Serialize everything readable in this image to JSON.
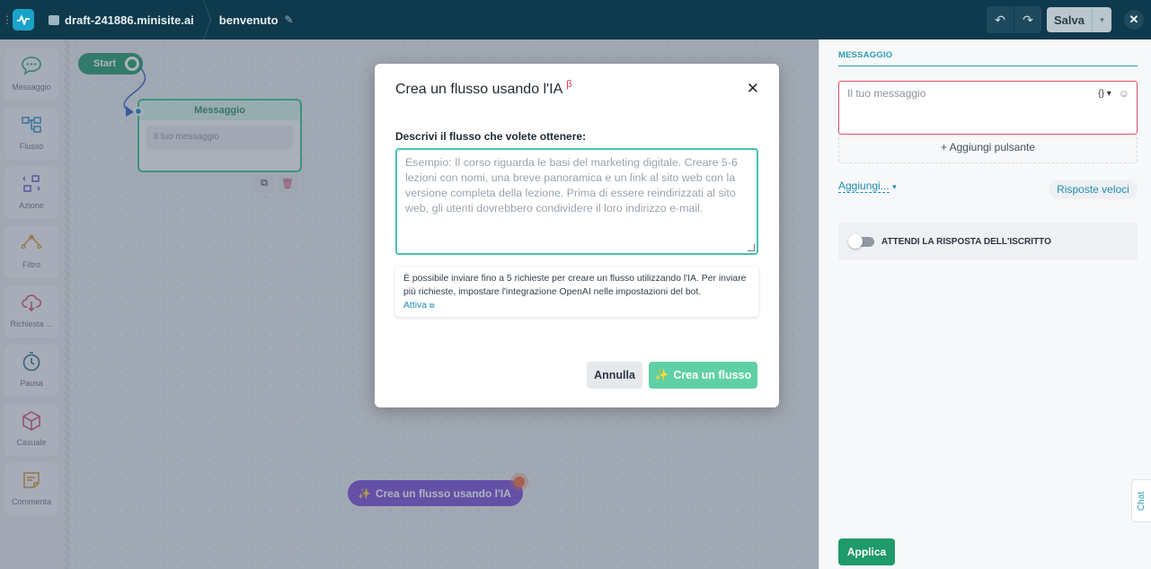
{
  "topbar": {
    "site": "draft-241886.minisite.ai",
    "flow_name": "benvenuto",
    "save_label": "Salva"
  },
  "sidebar": {
    "items": [
      {
        "label": "Messaggio",
        "icon": "message-icon"
      },
      {
        "label": "Flusso",
        "icon": "flow-icon"
      },
      {
        "label": "Azione",
        "icon": "action-icon"
      },
      {
        "label": "Filtro",
        "icon": "filter-icon"
      },
      {
        "label": "Richiesta ...",
        "icon": "request-icon"
      },
      {
        "label": "Pausa",
        "icon": "clock-icon"
      },
      {
        "label": "Casuale",
        "icon": "random-cube-icon"
      },
      {
        "label": "Commenta",
        "icon": "comment-icon"
      }
    ]
  },
  "canvas": {
    "start_label": "Start",
    "message_node": {
      "title": "Messaggio",
      "placeholder": "Il tuo messaggio"
    },
    "ai_button": "Crea un flusso usando l'IA"
  },
  "right_panel": {
    "title": "MESSAGGIO",
    "message_placeholder": "Il tuo messaggio",
    "add_button": "+ Aggiungi pulsante",
    "aggiungi": "Aggiungi...",
    "quick_replies": "Risposte veloci",
    "wait_label": "ATTENDI LA RISPOSTA DELL'ISCRITTO",
    "chat_tab": "Chat",
    "apply": "Applica"
  },
  "modal": {
    "title": "Crea un flusso usando l'IA",
    "beta": "β",
    "label": "Descrivi il flusso che volete ottenere:",
    "placeholder": "Esempio: Il corso riguarda le basi del marketing digitale. Creare 5-6 lezioni con nomi, una breve panoramica e un link al sito web con la versione completa della lezione. Prima di essere reindirizzati al sito web, gli utenti dovrebbero condividere il loro indirizzo e-mail.",
    "info": "È possibile inviare fino a 5 richieste per creare un flusso utilizzando l'IA. Per inviare più richieste, impostare l'integrazione OpenAI nelle impostazioni del bot.",
    "info_link": "Attiva",
    "cancel": "Annulla",
    "create": "Crea un flusso"
  },
  "colors": {
    "topbar": "#0f3a4d",
    "accent_green": "#1f9a6a",
    "accent_teal": "#46c2b0",
    "ai_purple": "#7a4bd8"
  }
}
